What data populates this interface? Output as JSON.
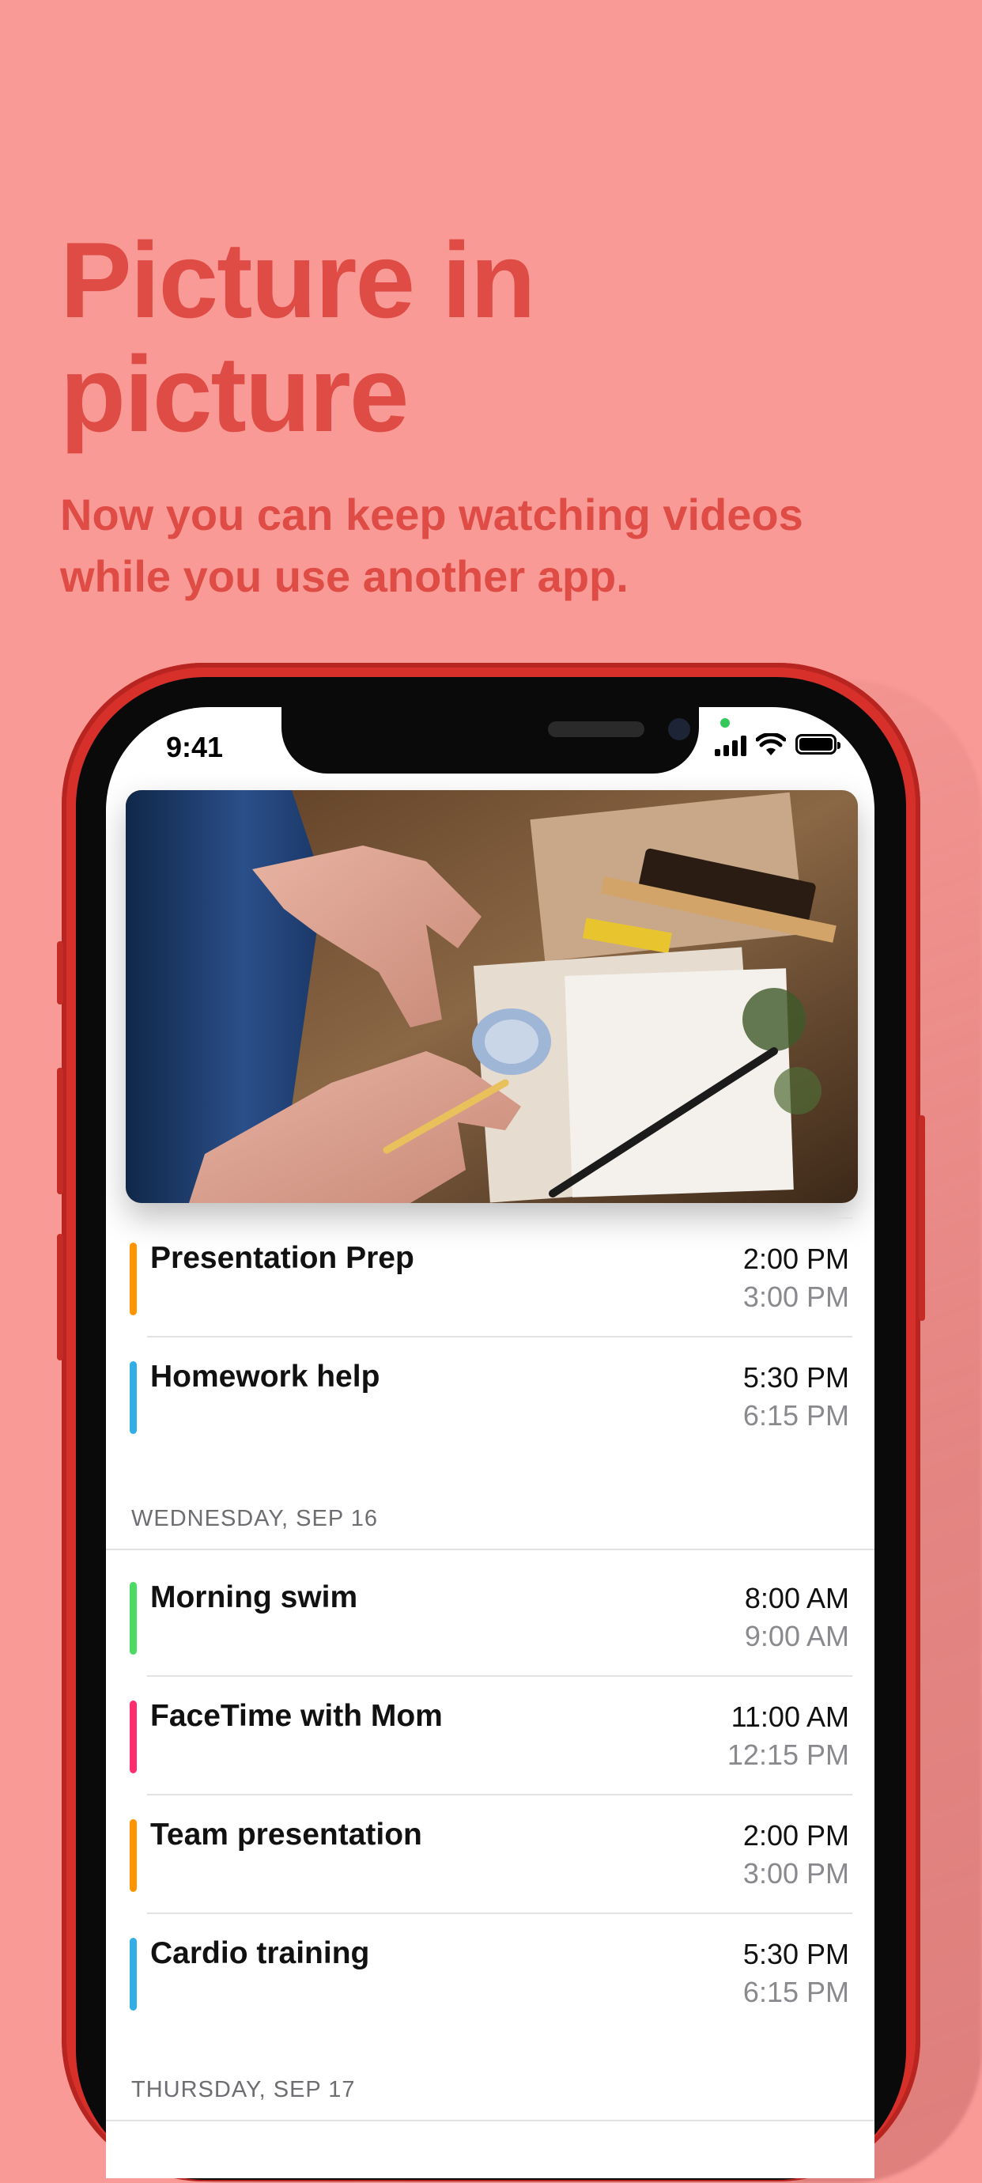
{
  "headline": {
    "line1": "Picture in",
    "line2": "picture"
  },
  "subhead": {
    "line1": "Now you can keep watching videos",
    "line2": "while you use another app."
  },
  "status_bar": {
    "time": "9:41"
  },
  "pip_video": {
    "subject": "hands sealing a letter with wax"
  },
  "colors": {
    "background": "#F99A96",
    "headline": "#DF4B45",
    "phone": "#D7302B",
    "orange": "#FF9500",
    "blue": "#32ADE6",
    "green": "#4CD964",
    "pink": "#FF2D6F"
  },
  "groups": [
    {
      "events": [
        {
          "title": "Presentation Prep",
          "start": "2:00 PM",
          "end": "3:00 PM",
          "color": "#FF9500"
        },
        {
          "title": "Homework help",
          "start": "5:30 PM",
          "end": "6:15 PM",
          "color": "#32ADE6"
        }
      ]
    },
    {
      "header": "WEDNESDAY, SEP 16",
      "events": [
        {
          "title": "Morning swim",
          "start": "8:00 AM",
          "end": "9:00 AM",
          "color": "#4CD964"
        },
        {
          "title": "FaceTime with Mom",
          "start": "11:00 AM",
          "end": "12:15 PM",
          "color": "#FF2D6F"
        },
        {
          "title": "Team presentation",
          "start": "2:00 PM",
          "end": "3:00 PM",
          "color": "#FF9500"
        },
        {
          "title": "Cardio training",
          "start": "5:30 PM",
          "end": "6:15 PM",
          "color": "#32ADE6"
        }
      ]
    },
    {
      "header": "THURSDAY, SEP 17",
      "events": []
    }
  ]
}
